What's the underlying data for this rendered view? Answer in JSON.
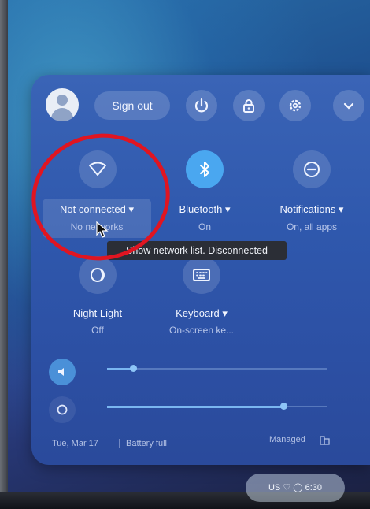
{
  "header": {
    "sign_out_label": "Sign out"
  },
  "tiles": [
    {
      "label": "Not connected ▾",
      "sub": "No networks",
      "icon": "wifi-icon",
      "active": false
    },
    {
      "label": "Bluetooth ▾",
      "sub": "On",
      "icon": "bluetooth-icon",
      "active": true
    },
    {
      "label": "Notifications ▾",
      "sub": "On, all apps",
      "icon": "do-not-disturb-icon",
      "active": false
    },
    {
      "label": "Night Light",
      "sub": "Off",
      "icon": "night-light-icon",
      "active": false
    },
    {
      "label": "Keyboard ▾",
      "sub": "On-screen ke...",
      "icon": "keyboard-icon",
      "active": false
    }
  ],
  "tooltip": "Show network list. Disconnected",
  "sliders": {
    "volume_level": 0.12,
    "brightness_level": 0.8
  },
  "footer": {
    "date": "Tue, Mar 17",
    "battery": "Battery full",
    "managed": "Managed"
  },
  "shelf": {
    "status_text": "US  ♡  ◯  6:30"
  },
  "colors": {
    "panel": "#2f58ad",
    "accent": "#4aa7f0",
    "annotation": "#e01521"
  }
}
